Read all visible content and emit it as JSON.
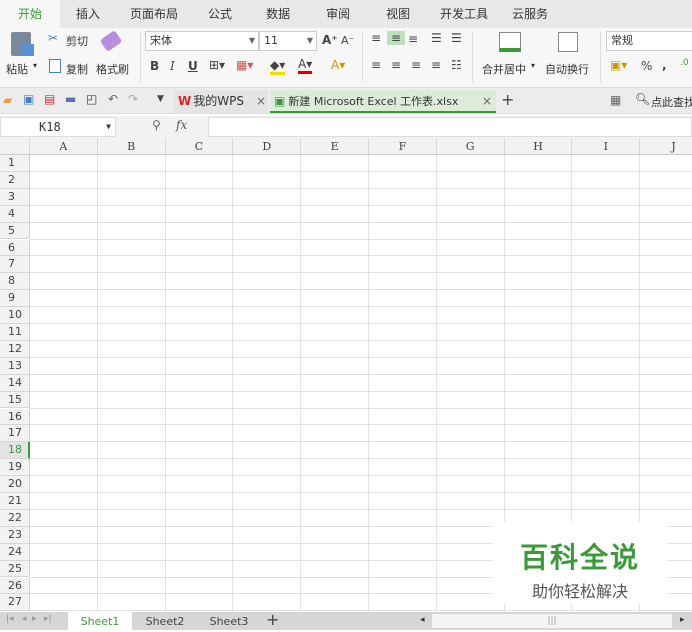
{
  "menu_tabs": [
    "开始",
    "插入",
    "页面布局",
    "公式",
    "数据",
    "审阅",
    "视图",
    "开发工具",
    "云服务"
  ],
  "ribbon": {
    "paste": "粘贴",
    "cut": "剪切",
    "copy": "复制",
    "format_painter": "格式刷",
    "font_name": "宋体",
    "font_size": "11",
    "bold": "B",
    "italic": "I",
    "underline": "U",
    "merge_center": "合并居中",
    "wrap_text": "自动换行",
    "number_format": "常规",
    "percent": "%",
    "comma": ","
  },
  "quick_bar": {
    "my_wps": "我的WPS",
    "doc_tab": "新建 Microsoft Excel 工作表.xlsx",
    "close": "×",
    "add": "+",
    "search": "点此查找"
  },
  "formula_bar": {
    "name_box": "K18",
    "fx": "fx",
    "value": ""
  },
  "columns": [
    "A",
    "B",
    "C",
    "D",
    "E",
    "F",
    "G",
    "H",
    "I",
    "J"
  ],
  "rows": [
    "1",
    "2",
    "3",
    "4",
    "5",
    "6",
    "7",
    "8",
    "9",
    "10",
    "11",
    "12",
    "13",
    "14",
    "15",
    "16",
    "17",
    "18",
    "19",
    "20",
    "21",
    "22",
    "23",
    "24",
    "25",
    "26",
    "27"
  ],
  "active_row": "18",
  "sheets": [
    "Sheet1",
    "Sheet2",
    "Sheet3"
  ],
  "active_sheet": "Sheet1",
  "watermark": {
    "title": "百科全说",
    "subtitle": "助你轻松解决"
  },
  "colors": {
    "accent": "#3a9a3a"
  }
}
